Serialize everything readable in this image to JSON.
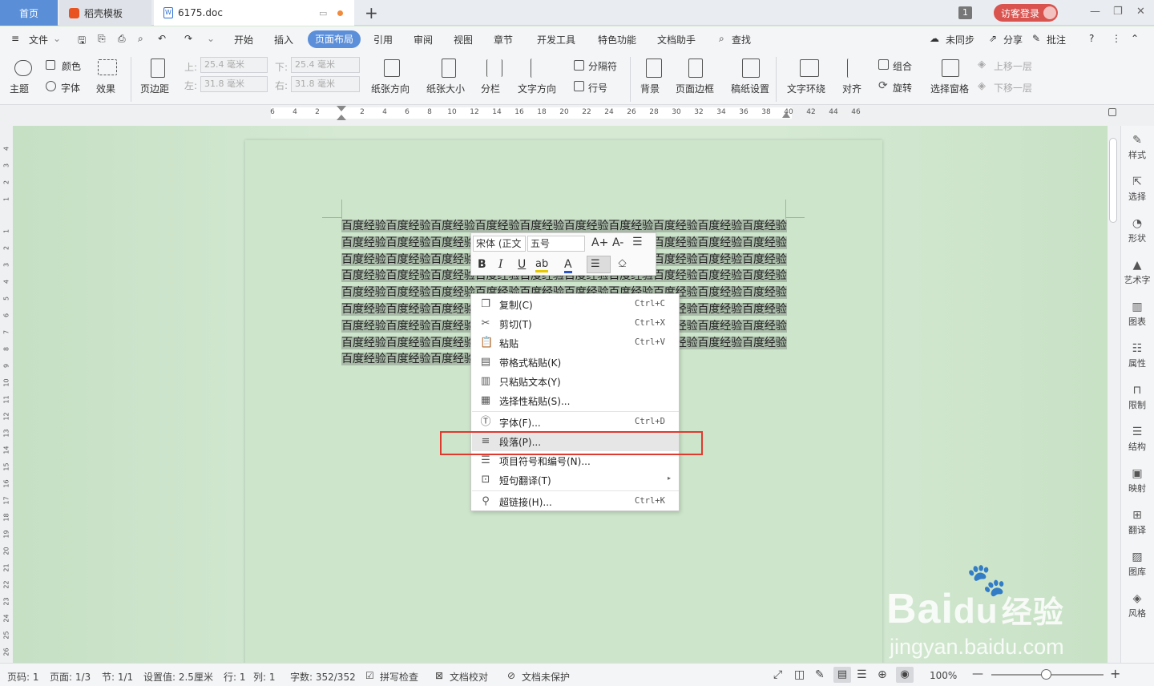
{
  "titlebar": {
    "tabs": [
      {
        "label": "首页"
      },
      {
        "label": "稻壳模板"
      },
      {
        "label": "6175.doc"
      }
    ],
    "badge_count": "1",
    "login_label": "访客登录",
    "window_buttons": [
      "minimize-icon",
      "restore-icon",
      "close-icon"
    ]
  },
  "menubar": {
    "file_label": "文件",
    "items": [
      "开始",
      "插入",
      "页面布局",
      "引用",
      "审阅",
      "视图",
      "章节",
      "开发工具",
      "特色功能",
      "文档助手"
    ],
    "active_item": "页面布局",
    "search_label": "查找",
    "sync_label": "未同步",
    "share_label": "分享",
    "comment_label": "批注"
  },
  "ribbon": {
    "theme_label": "主题",
    "color_label": "颜色",
    "font_label": "字体",
    "effect_label": "效果",
    "margin_label": "页边距",
    "top_label": "上:",
    "top_value": "25.4 毫米",
    "bottom_label": "下:",
    "bottom_value": "25.4 毫米",
    "left_label": "左:",
    "left_value": "31.8 毫米",
    "right_label": "右:",
    "right_value": "31.8 毫米",
    "orientation_label": "纸张方向",
    "size_label": "纸张大小",
    "columns_label": "分栏",
    "text_direction_label": "文字方向",
    "separator_label": "分隔符",
    "line_numbers_label": "行号",
    "background_label": "背景",
    "page_border_label": "页面边框",
    "draft_setting_label": "稿纸设置",
    "wrap_label": "文字环绕",
    "align_label": "对齐",
    "group_label": "组合",
    "rotate_label": "旋转",
    "selection_pane_label": "选择窗格",
    "bring_forward_label": "上移一层",
    "send_backward_label": "下移一层"
  },
  "ruler": {
    "horizontal_ticks": [
      "6",
      "4",
      "2",
      "2",
      "4",
      "6",
      "8",
      "10",
      "12",
      "14",
      "16",
      "18",
      "20",
      "22",
      "24",
      "26",
      "28",
      "30",
      "32",
      "34",
      "36",
      "38",
      "40",
      "42",
      "44",
      "46"
    ],
    "vertical_ticks": [
      "4",
      "3",
      "2",
      "1",
      "1",
      "2",
      "3",
      "4",
      "5",
      "6",
      "7",
      "8",
      "9",
      "10",
      "11",
      "12",
      "13",
      "14",
      "15",
      "16",
      "17",
      "18",
      "19",
      "20",
      "21",
      "22",
      "23",
      "24",
      "25",
      "26"
    ]
  },
  "document": {
    "text": "百度经验百度经验百度经验百度经验百度经验百度经验百度经验百度经验百度经验百度经验百度经验百度经验百度经验百度经验百度经验百度经验百度经验百度经验百度经验百度经验百度经验百度经验百度经验百度经验百度经验百度经验百度经验百度经验百度经验百度经验百度经验百度经验百度经验百度经验百度经验百度经验百度经验百度经验百度经验百度经验百度经验百度经验百度经验百度经验百度经验百度经验百度经验百度经验百度经验百度经验百度经验百度经验百度经验百度经验百度经验百度经验百度经验百度经验百度经验百度经验百度经验百度经验百度经验百度经验百度经验百度经验百度经验百度经验百度经验百度经验百度经验百度经验百度经验百度经验百度经验百度经验百度经验百度经验百度经验百度经验百度经验百度经验百度经验百度经验"
  },
  "mini_toolbar": {
    "font_name": "宋体 (正文",
    "font_size": "五号",
    "grow_font": "A+",
    "shrink_font": "A-",
    "bold": "B",
    "italic": "I",
    "underline": "U",
    "highlight": "ab",
    "font_color": "A"
  },
  "context_menu": {
    "items": [
      {
        "icon": "copy-icon",
        "label": "复制(C)",
        "shortcut": "Ctrl+C"
      },
      {
        "icon": "cut-icon",
        "label": "剪切(T)",
        "shortcut": "Ctrl+X"
      },
      {
        "icon": "paste-icon",
        "label": "粘贴",
        "shortcut": "Ctrl+V"
      },
      {
        "icon": "paste-format-icon",
        "label": "带格式粘贴(K)",
        "shortcut": ""
      },
      {
        "icon": "paste-text-icon",
        "label": "只粘贴文本(Y)",
        "shortcut": ""
      },
      {
        "icon": "paste-special-icon",
        "label": "选择性粘贴(S)...",
        "shortcut": ""
      },
      {
        "icon": "font-icon",
        "label": "字体(F)...",
        "shortcut": "Ctrl+D"
      },
      {
        "icon": "paragraph-icon",
        "label": "段落(P)...",
        "shortcut": ""
      },
      {
        "icon": "bullets-icon",
        "label": "项目符号和编号(N)...",
        "shortcut": ""
      },
      {
        "icon": "translate-icon",
        "label": "短句翻译(T)",
        "shortcut": ""
      },
      {
        "icon": "hyperlink-icon",
        "label": "超链接(H)...",
        "shortcut": "Ctrl+K"
      }
    ],
    "highlighted_item": "段落(P)..."
  },
  "right_panel": {
    "items": [
      "样式",
      "选择",
      "形状",
      "艺术字",
      "图表",
      "属性",
      "限制",
      "结构",
      "映射",
      "翻译",
      "图库",
      "风格"
    ]
  },
  "statusbar": {
    "page_no": "页码: 1",
    "pages": "页面: 1/3",
    "section": "节: 1/1",
    "setting": "设置值: 2.5厘米",
    "row": "行: 1",
    "col": "列: 1",
    "word_count": "字数: 352/352",
    "spell_check": "拼写检查",
    "doc_proof": "文档校对",
    "doc_protect": "文档未保护",
    "zoom": "100%",
    "zoom_level": 1.0
  },
  "watermark": {
    "logo_text": "Bai",
    "logo_suffix": "经验",
    "url": "jingyan.baidu.com"
  },
  "colors": {
    "accent": "#5b8fd9",
    "login": "#d9534f",
    "highlight_box": "#e03a2f",
    "page_bg": "#cde6cb"
  }
}
